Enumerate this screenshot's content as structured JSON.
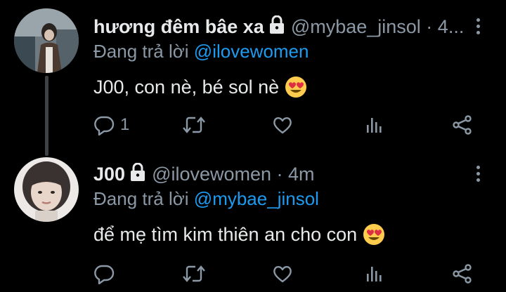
{
  "colors": {
    "background": "#000000",
    "text": "#e7e9ea",
    "muted": "#8b98a5",
    "accent": "#1d9bf0",
    "thread_line": "#3e4144"
  },
  "tweets": [
    {
      "display_name": "hương đêm bâe xa",
      "handle_time": "@mybae_jinsol · 4...",
      "reply_prefix": "Đang trả lời",
      "reply_mention": "@ilovewomen",
      "text": "J00, con nè, bé sol nè",
      "emoji": "smiling-face-with-heart-eyes",
      "reply_count": "1",
      "icons": [
        "reply-icon",
        "retweet-icon",
        "like-icon",
        "views-icon",
        "share-icon"
      ]
    },
    {
      "display_name": "J00",
      "handle_time": "@ilovewomen · 4m",
      "reply_prefix": "Đang trả lời",
      "reply_mention": "@mybae_jinsol",
      "text": "để mẹ tìm kim thiên an cho con",
      "emoji": "smiling-face-with-heart-eyes",
      "reply_count": "",
      "icons": [
        "reply-icon",
        "retweet-icon",
        "like-icon",
        "views-icon",
        "share-icon"
      ]
    }
  ]
}
